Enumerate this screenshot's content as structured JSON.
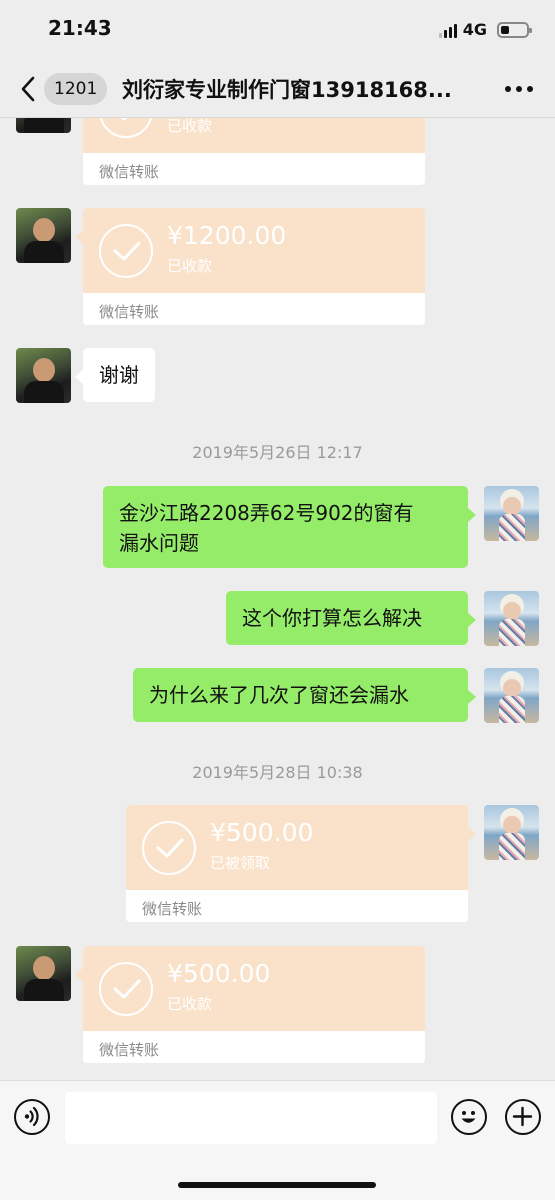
{
  "status_bar": {
    "time": "21:43",
    "network": "4G"
  },
  "nav": {
    "unread_count": "1201",
    "title": "刘衍家专业制作门窗13918168..."
  },
  "messages": {
    "t0_label": "微信转账",
    "t1_amount": "¥1200.00",
    "t1_status": "已收款",
    "t1_label": "微信转账",
    "m1_text": "谢谢",
    "ts1": "2019年5月26日 12:17",
    "m2_text_line1": "金沙江路2208弄62号902的窗有",
    "m2_text_line2": "漏水问题",
    "m3_text": "这个你打算怎么解决",
    "m4_text": "为什么来了几次了窗还会漏水",
    "ts2": "2019年5月28日 10:38",
    "t2_amount": "¥500.00",
    "t2_status": "已被领取",
    "t2_label": "微信转账",
    "t3_amount": "¥500.00",
    "t3_status": "已收款",
    "t3_label": "微信转账"
  },
  "icons": {
    "back": "chevron-left-icon",
    "more": "more-dots-icon",
    "voice": "voice-icon",
    "emoji": "emoji-icon",
    "plus": "plus-icon",
    "transfer_check": "check-icon"
  },
  "colors": {
    "transfer_bg": "#f9e2c9",
    "bubble_green": "#95ec69",
    "chat_bg": "#ededed"
  }
}
